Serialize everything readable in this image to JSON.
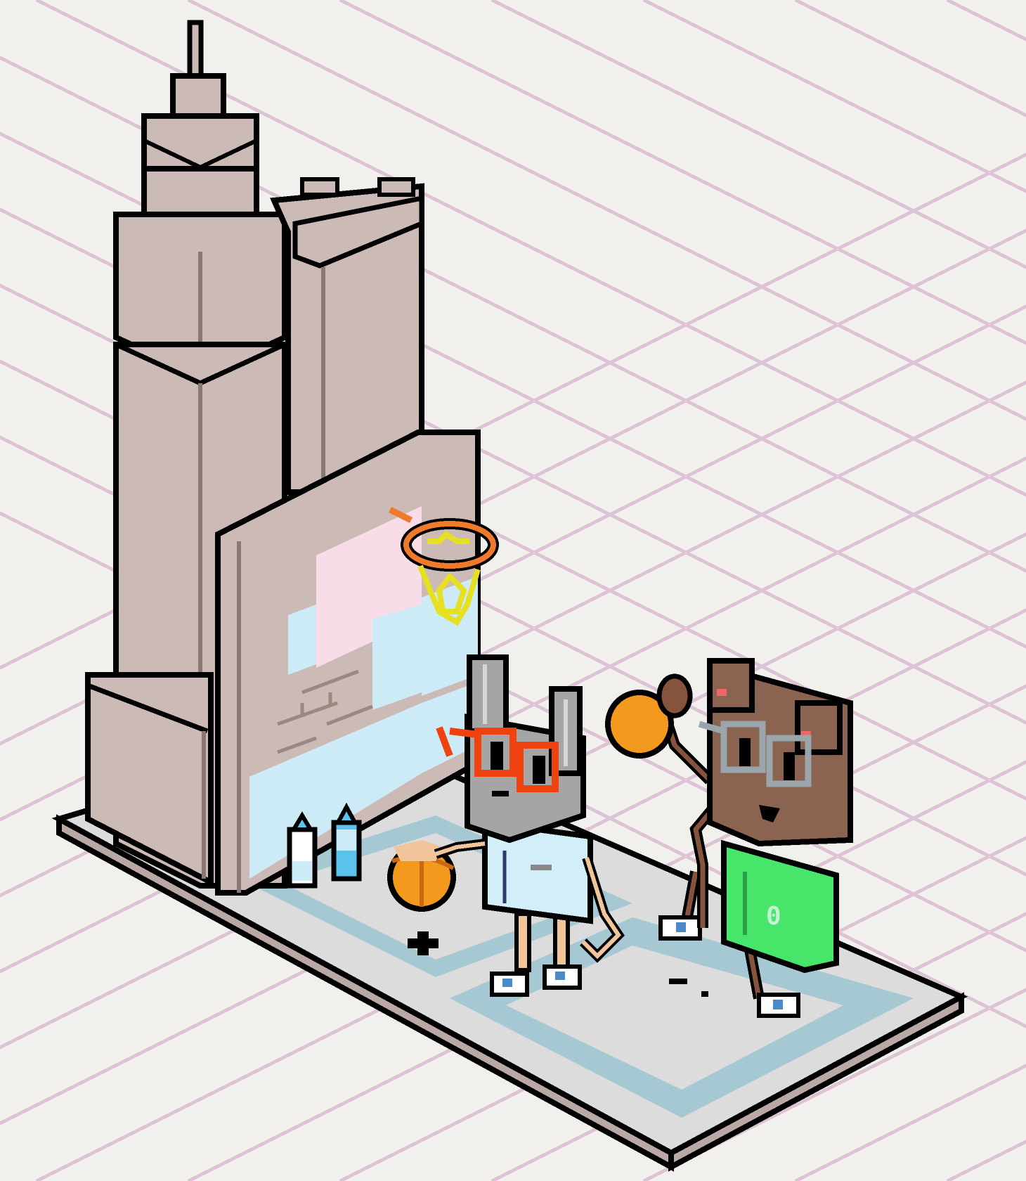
{
  "scene": {
    "description_name": "isometric-pixel-art-basketball",
    "jersey_number": "0"
  },
  "colors": {
    "background": "#f1f0ed",
    "grid": "#dcc3d6",
    "building": "#cbbab5",
    "building_shadow": "#b8a6a1",
    "outline": "#000000",
    "court_light": "#dcdcdc",
    "court_blue": "#a6c8d2",
    "pink_light": "#f8dde8",
    "sky_light": "#cdebf6",
    "hoop_orange": "#f07a2b",
    "net_yellow": "#e6df22",
    "ball_orange": "#f39a1e",
    "grey_head": "#a5a5a5",
    "glasses_red": "#f0420e",
    "shirt_blue": "#d2eef8",
    "skin": "#f2c49a",
    "brown_head": "#8a6450",
    "brown_skin": "#86533c",
    "glasses_grey": "#9aa6ab",
    "shirt_green": "#48e56b",
    "bottle_blue": "#5bc2ec",
    "shoe_blue": "#4a8ac8"
  },
  "icons": {
    "left_player": "rabbit-player-icon",
    "right_player": "bear-player-icon",
    "hoop": "basketball-hoop-icon",
    "ball": "basketball-icon"
  }
}
